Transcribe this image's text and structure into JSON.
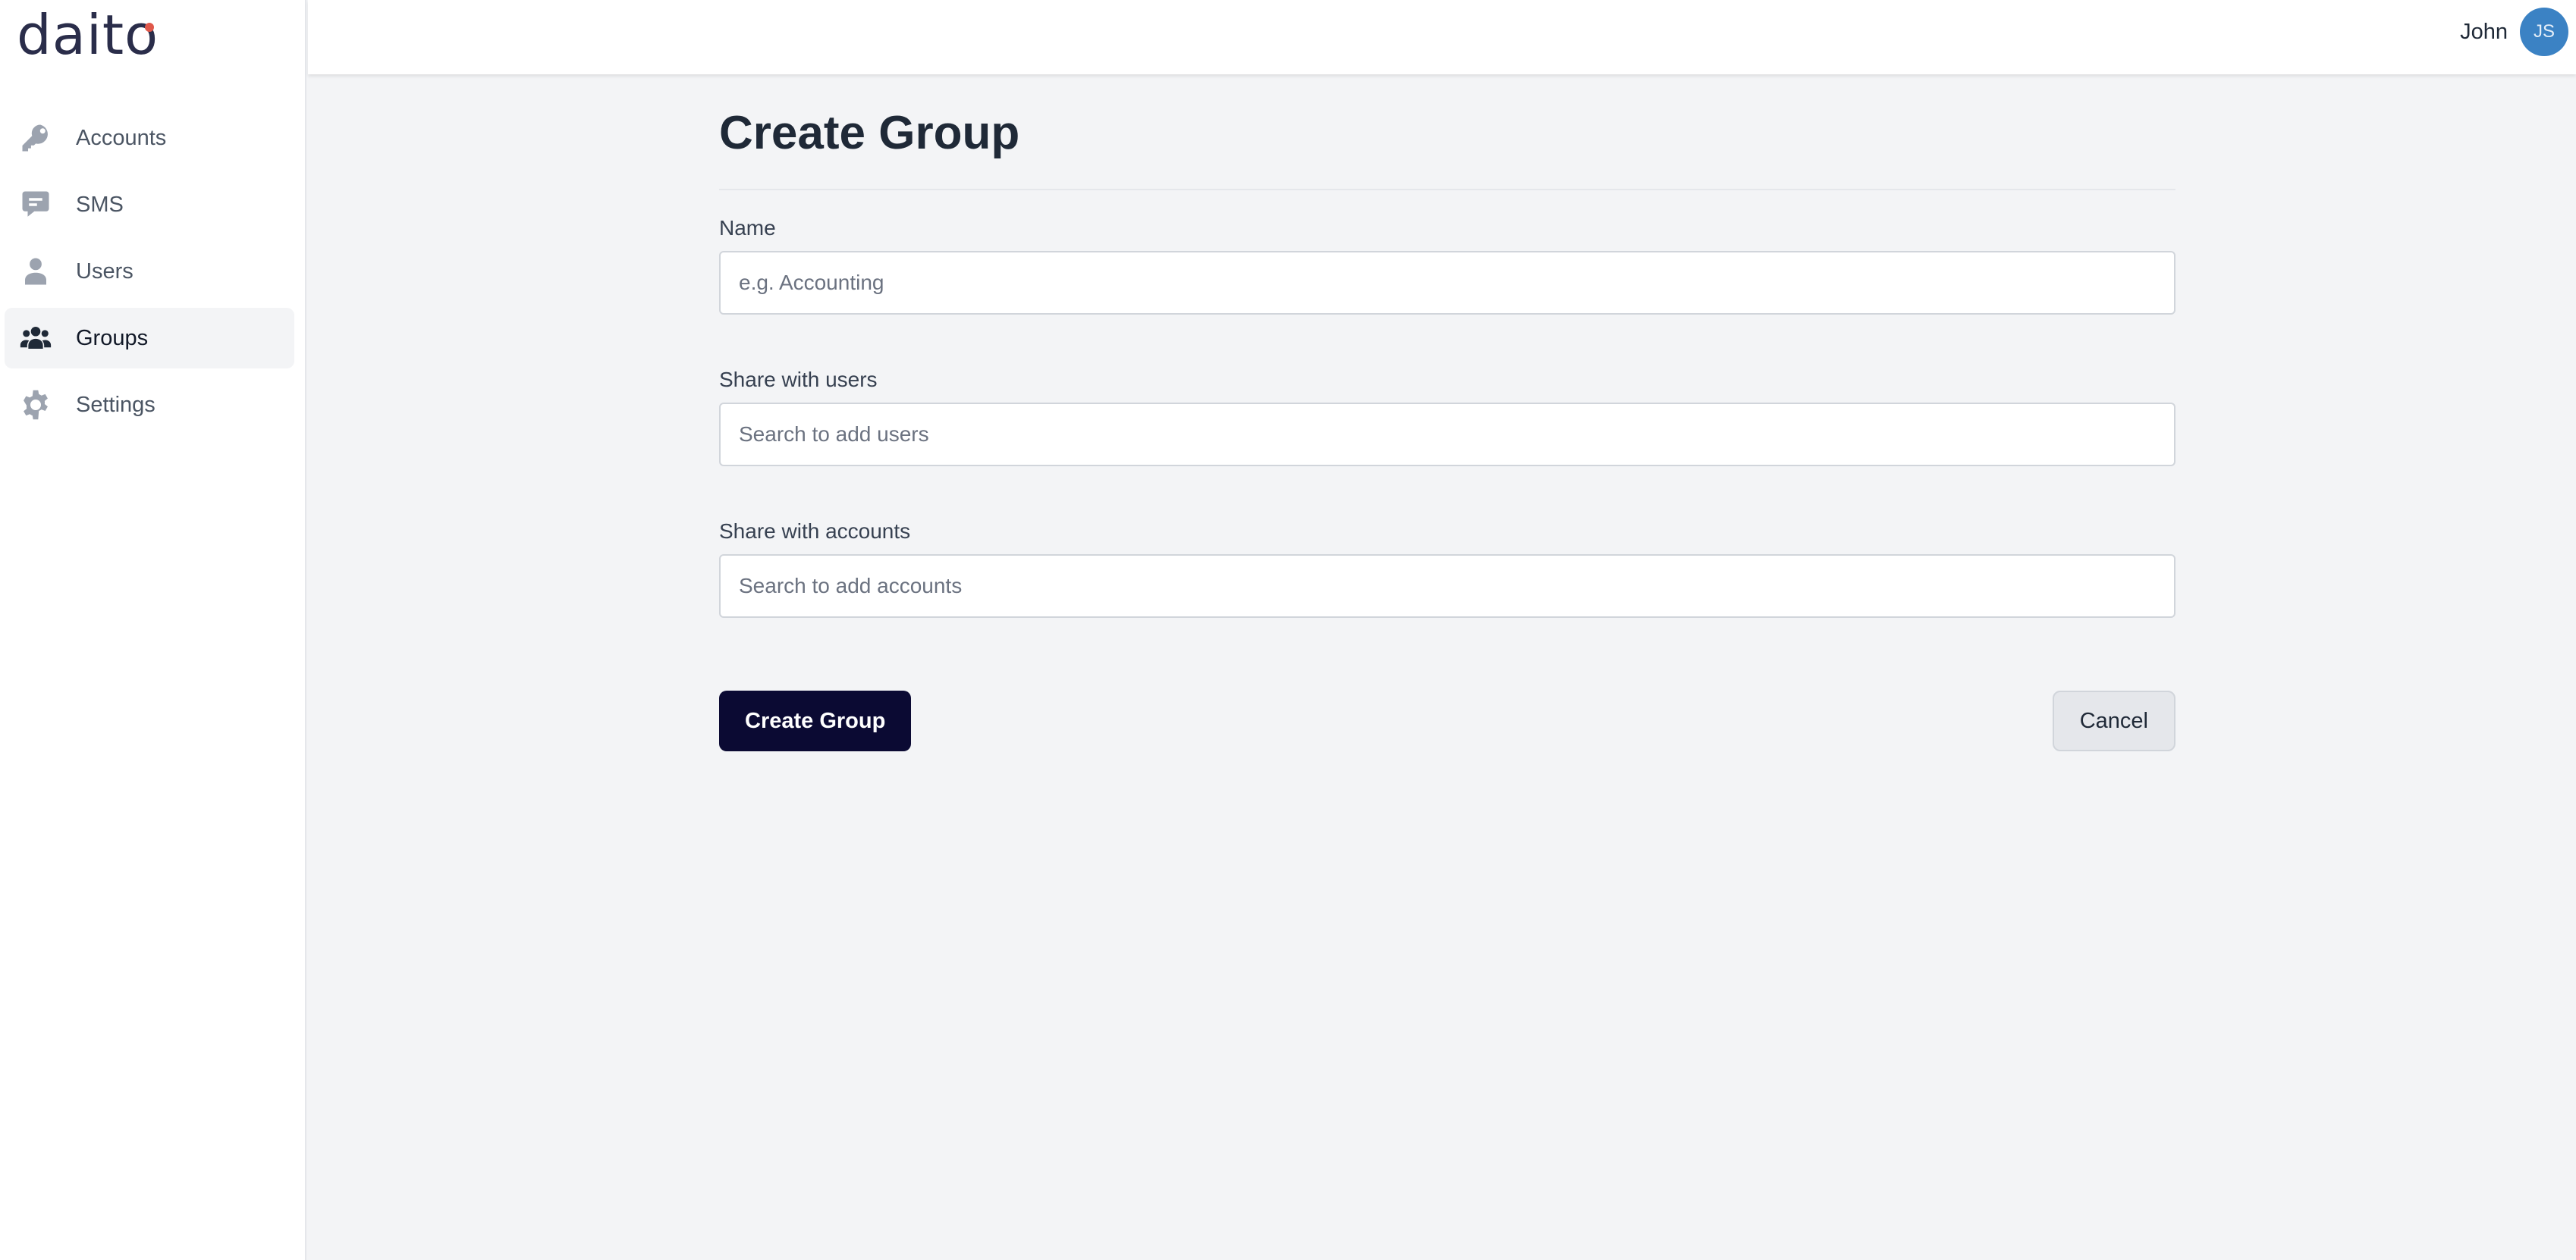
{
  "app": {
    "logo_text": "daito",
    "brand_accent": "#e0584a"
  },
  "sidebar": {
    "items": [
      {
        "label": "Accounts",
        "icon": "key-icon",
        "active": false
      },
      {
        "label": "SMS",
        "icon": "chat-icon",
        "active": false
      },
      {
        "label": "Users",
        "icon": "user-icon",
        "active": false
      },
      {
        "label": "Groups",
        "icon": "users-group-icon",
        "active": true
      },
      {
        "label": "Settings",
        "icon": "gear-icon",
        "active": false
      }
    ]
  },
  "header": {
    "user_name": "John",
    "avatar_initials": "JS",
    "avatar_color": "#3b82c4"
  },
  "form": {
    "title": "Create Group",
    "fields": [
      {
        "label": "Name",
        "value": "",
        "placeholder": "e.g. Accounting"
      },
      {
        "label": "Share with users",
        "value": "",
        "placeholder": "Search to add users"
      },
      {
        "label": "Share with accounts",
        "value": "",
        "placeholder": "Search to add accounts"
      }
    ],
    "submit_label": "Create Group",
    "cancel_label": "Cancel",
    "submit_color": "#0b0a33"
  }
}
